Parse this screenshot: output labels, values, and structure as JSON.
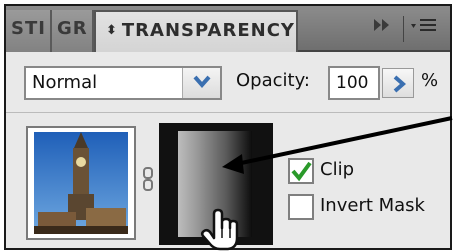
{
  "tabs": [
    {
      "label": "STI",
      "active": false
    },
    {
      "label": "GR",
      "active": false
    },
    {
      "label": "TRANSPARENCY",
      "active": true,
      "icon": "up-down-arrows-icon"
    }
  ],
  "tab_controls": {
    "expand_icon": "double-arrow-icon",
    "menu_icon": "panel-menu-icon"
  },
  "blend_mode": {
    "value": "Normal",
    "icon": "chevron-down-icon"
  },
  "opacity": {
    "label": "Opacity:",
    "value": "100",
    "unit": "%",
    "stepper_icon": "chevron-right-icon"
  },
  "thumbnails": {
    "artwork": {
      "alt": "Clock tower artwork thumbnail"
    },
    "link_icon": "link-icon",
    "mask": {
      "selected": true
    }
  },
  "options": {
    "clip": {
      "label": "Clip",
      "checked": true
    },
    "invert_mask": {
      "label": "Invert Mask",
      "checked": false
    }
  },
  "colors": {
    "accent": "#3a6fb0",
    "check": "#2a9a2a",
    "panel_bg": "#e9e9e9",
    "tab_bg": "#7d7d7d"
  }
}
